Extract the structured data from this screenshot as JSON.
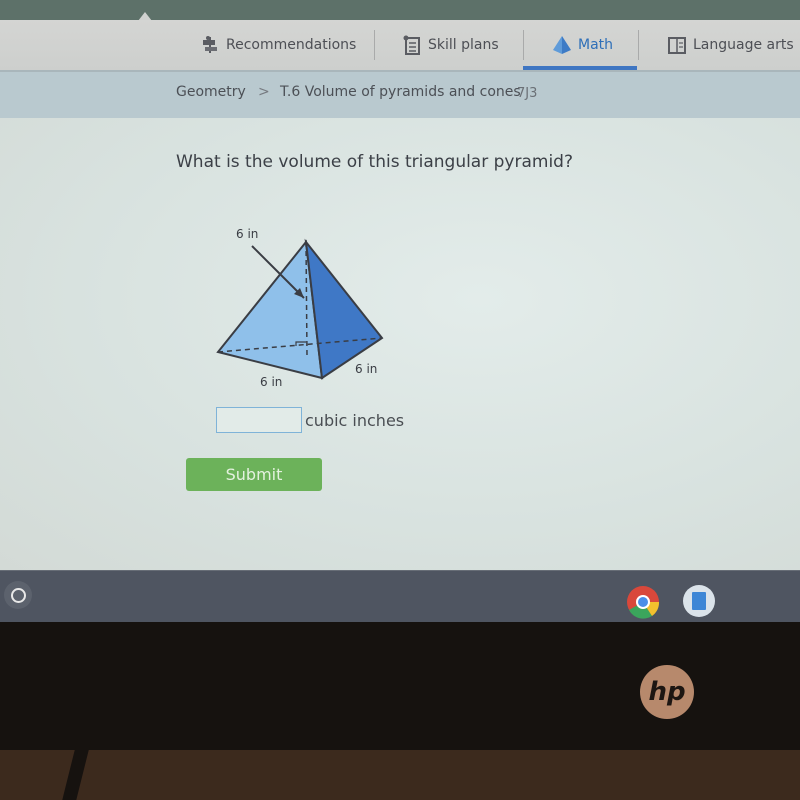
{
  "nav": {
    "items": [
      {
        "label": "Recommendations",
        "icon": "signpost-icon",
        "active": false
      },
      {
        "label": "Skill plans",
        "icon": "clipboard-icon",
        "active": false
      },
      {
        "label": "Math",
        "icon": "pyramid-icon",
        "active": true
      },
      {
        "label": "Language arts",
        "icon": "book-icon",
        "active": false
      }
    ],
    "active_color": "#3f76c2"
  },
  "breadcrumb": {
    "subject": "Geometry",
    "separator": ">",
    "skill": "T.6 Volume of pyramids and cones",
    "code": "7J3"
  },
  "question": {
    "prompt": "What is the volume of this triangular pyramid?",
    "figure": {
      "height_label": "6 in",
      "base_left_label": "6 in",
      "base_right_label": "6 in"
    },
    "answer_value": "",
    "unit": "cubic inches",
    "submit_label": "Submit",
    "submit_color": "#6cb25a"
  },
  "shelf": {
    "apps": [
      "chrome-icon",
      "docs-icon"
    ]
  },
  "device": {
    "logo": "hp"
  }
}
